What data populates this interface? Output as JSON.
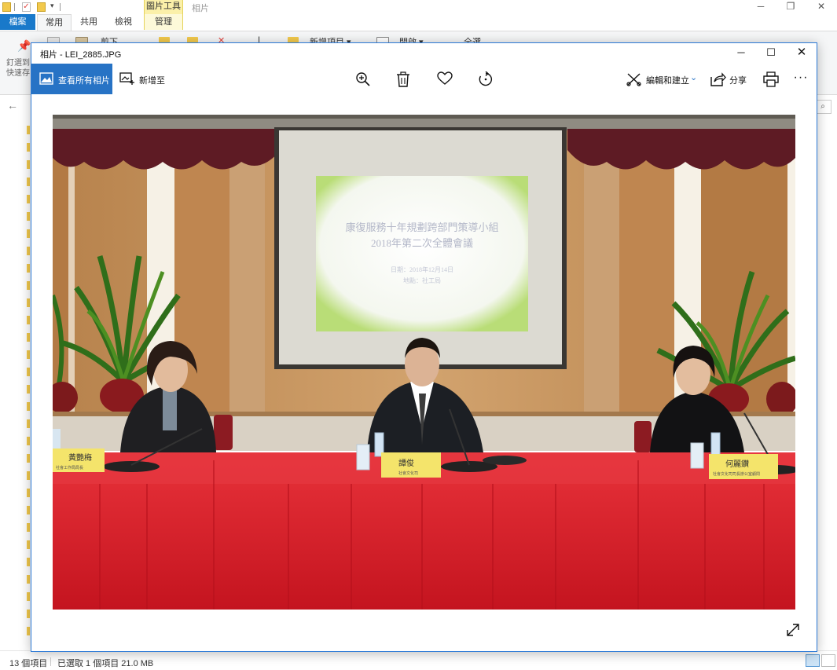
{
  "explorer": {
    "title": "相片",
    "qat_dropdown": "▾",
    "contextual_tab_group": "圖片工具",
    "tabs": {
      "file": "檔案",
      "home": "常用",
      "share": "共用",
      "view": "檢視",
      "manage": "管理"
    },
    "ribbon": {
      "pin_label": "釘選到快速存",
      "cut": "剪下",
      "new_item": "新增項目 ▾",
      "open": "開啟 ▾",
      "select_all": "全選"
    },
    "status": {
      "item_count": "13 個項目",
      "selected": "已選取 1 個項目  21.0 MB"
    }
  },
  "photos": {
    "window_title": "相片 - LEI_2885.JPG",
    "toolbar": {
      "view_all": "查看所有相片",
      "add_to": "新增至",
      "edit_create": "編輯和建立",
      "share": "分享"
    },
    "photo": {
      "projector_title_line1": "康復服務十年規劃跨部門策導小組",
      "projector_title_line2": "2018年第二次全體會議",
      "projector_detail_line1": "日期：2018年12月14日",
      "projector_detail_line2": "地點：社工局",
      "nameplate_left": "黃艷梅",
      "nameplate_left_sub": "社會工作局局長",
      "nameplate_center": "譚俊",
      "nameplate_center_sub": "社會文化司",
      "nameplate_right": "何麗鑽",
      "nameplate_right_sub": "社會文化司司長辦公室顧問"
    }
  },
  "colors": {
    "accent_blue": "#2773c5",
    "file_tab_blue": "#1979ca",
    "tablecloth_red": "#d51f2a",
    "wall_wood": "#c6945a",
    "curtain_maroon": "#5e1b24"
  }
}
